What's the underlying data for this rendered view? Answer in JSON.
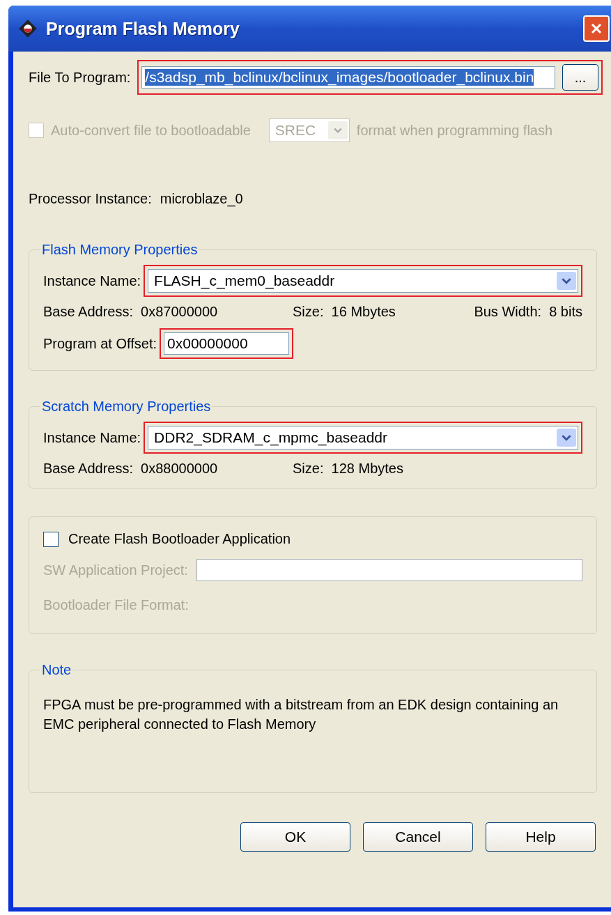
{
  "window": {
    "title": "Program Flash Memory"
  },
  "file": {
    "label": "File To Program:",
    "value": "/s3adsp_mb_bclinux/bclinux_images/bootloader_bclinux.bin",
    "selected": true,
    "highlighted": true,
    "browse": "..."
  },
  "auto_convert": {
    "label": "Auto-convert file to bootloadable",
    "checked": false,
    "disabled": true,
    "format": "SREC",
    "suffix": "format when programming flash"
  },
  "processor": {
    "label": "Processor Instance:",
    "value": "microblaze_0"
  },
  "flash_group": {
    "title": "Flash Memory Properties",
    "instance": {
      "label": "Instance Name:",
      "value": "FLASH_c_mem0_baseaddr",
      "highlighted": true
    },
    "details": [
      {
        "label": "Base Address:",
        "value": "0x87000000"
      },
      {
        "label": "Size:",
        "value": "16 Mbytes"
      },
      {
        "label": "Bus Width:",
        "value": "8 bits"
      }
    ],
    "offset": {
      "label": "Program at Offset:",
      "value": "0x00000000",
      "highlighted": true
    }
  },
  "scratch_group": {
    "title": "Scratch Memory Properties",
    "instance": {
      "label": "Instance Name:",
      "value": "DDR2_SDRAM_c_mpmc_baseaddr",
      "highlighted": true
    },
    "details": [
      {
        "label": "Base Address:",
        "value": "0x88000000"
      },
      {
        "label": "Size:",
        "value": "128 Mbytes"
      }
    ]
  },
  "bootloader_group": {
    "checkbox": {
      "label": "Create Flash Bootloader Application",
      "checked": false
    },
    "fields": [
      {
        "kind": "input",
        "label": "SW Application Project:",
        "disabled": true
      },
      {
        "kind": "label",
        "label": "Bootloader File Format:",
        "disabled": true
      }
    ]
  },
  "note": {
    "title": "Note",
    "text": "FPGA must be pre-programmed with a bitstream from an EDK design containing an EMC peripheral connected to Flash Memory"
  },
  "buttons": [
    "OK",
    "Cancel",
    "Help"
  ]
}
